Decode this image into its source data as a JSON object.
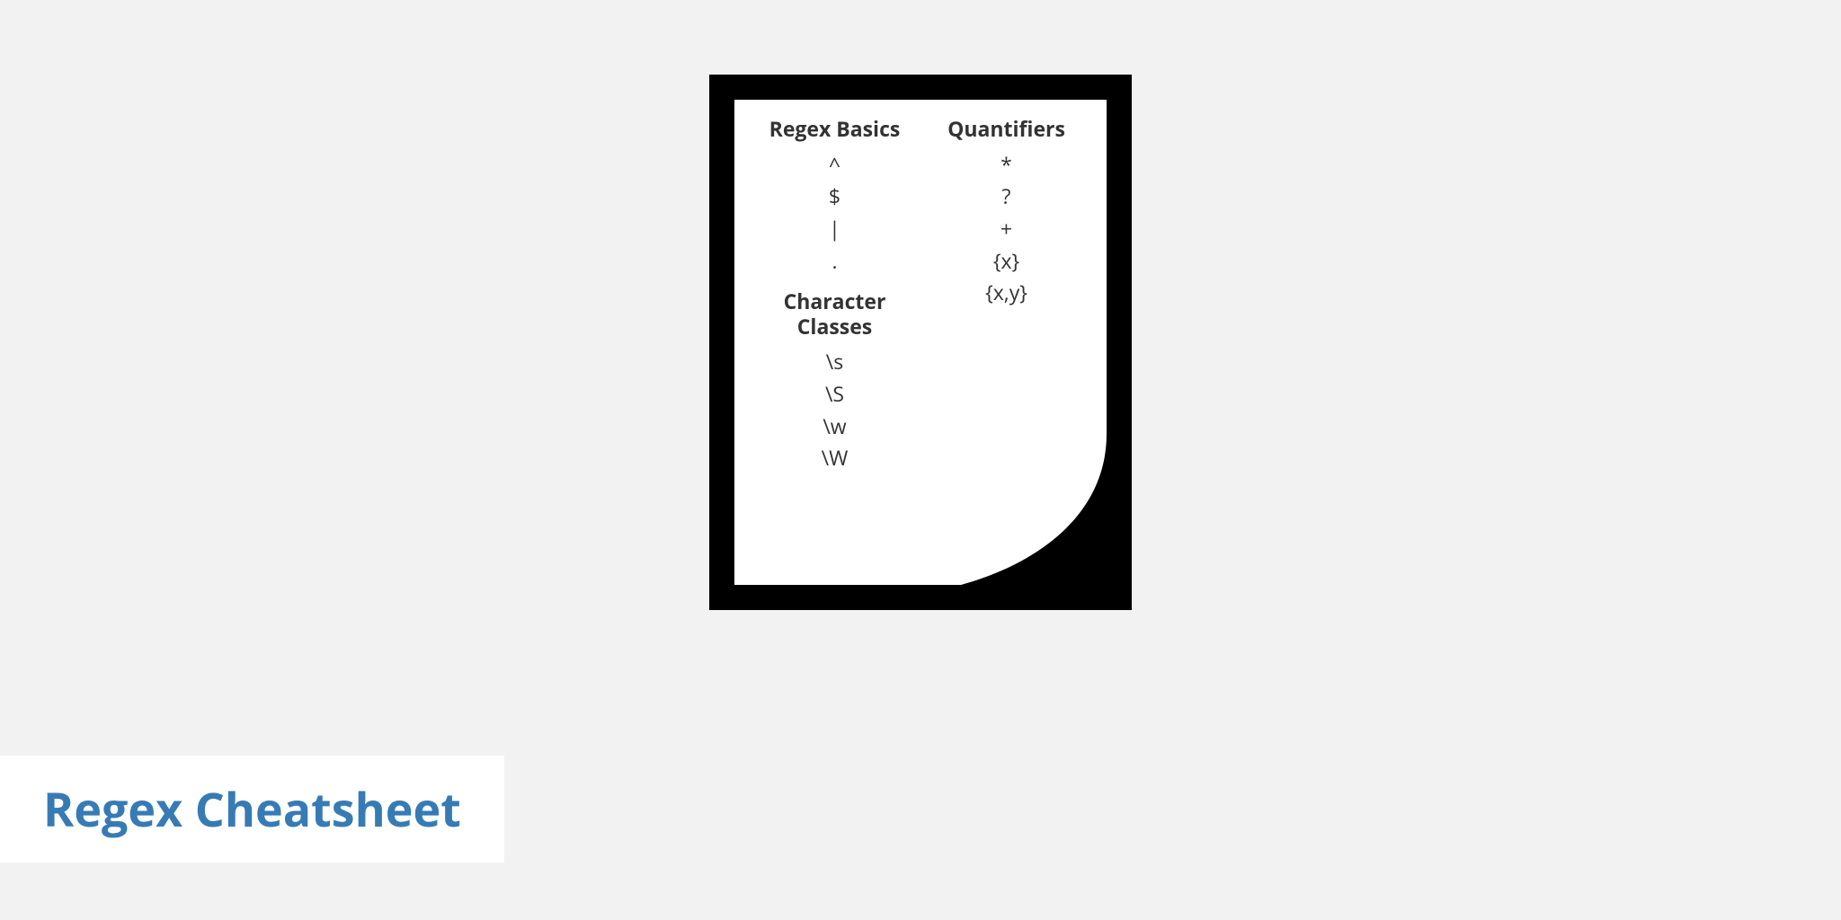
{
  "title": "Regex Cheatsheet",
  "sections": {
    "basics": {
      "heading": "Regex Basics",
      "items": [
        "^",
        "$",
        "|",
        "."
      ]
    },
    "quantifiers": {
      "heading": "Quantifiers",
      "items": [
        "*",
        "?",
        "+",
        "{x}",
        "{x,y}"
      ]
    },
    "char_classes": {
      "heading_line1": "Character",
      "heading_line2": "Classes",
      "items": [
        "\\s",
        "\\S",
        "\\w",
        "\\W"
      ]
    }
  }
}
